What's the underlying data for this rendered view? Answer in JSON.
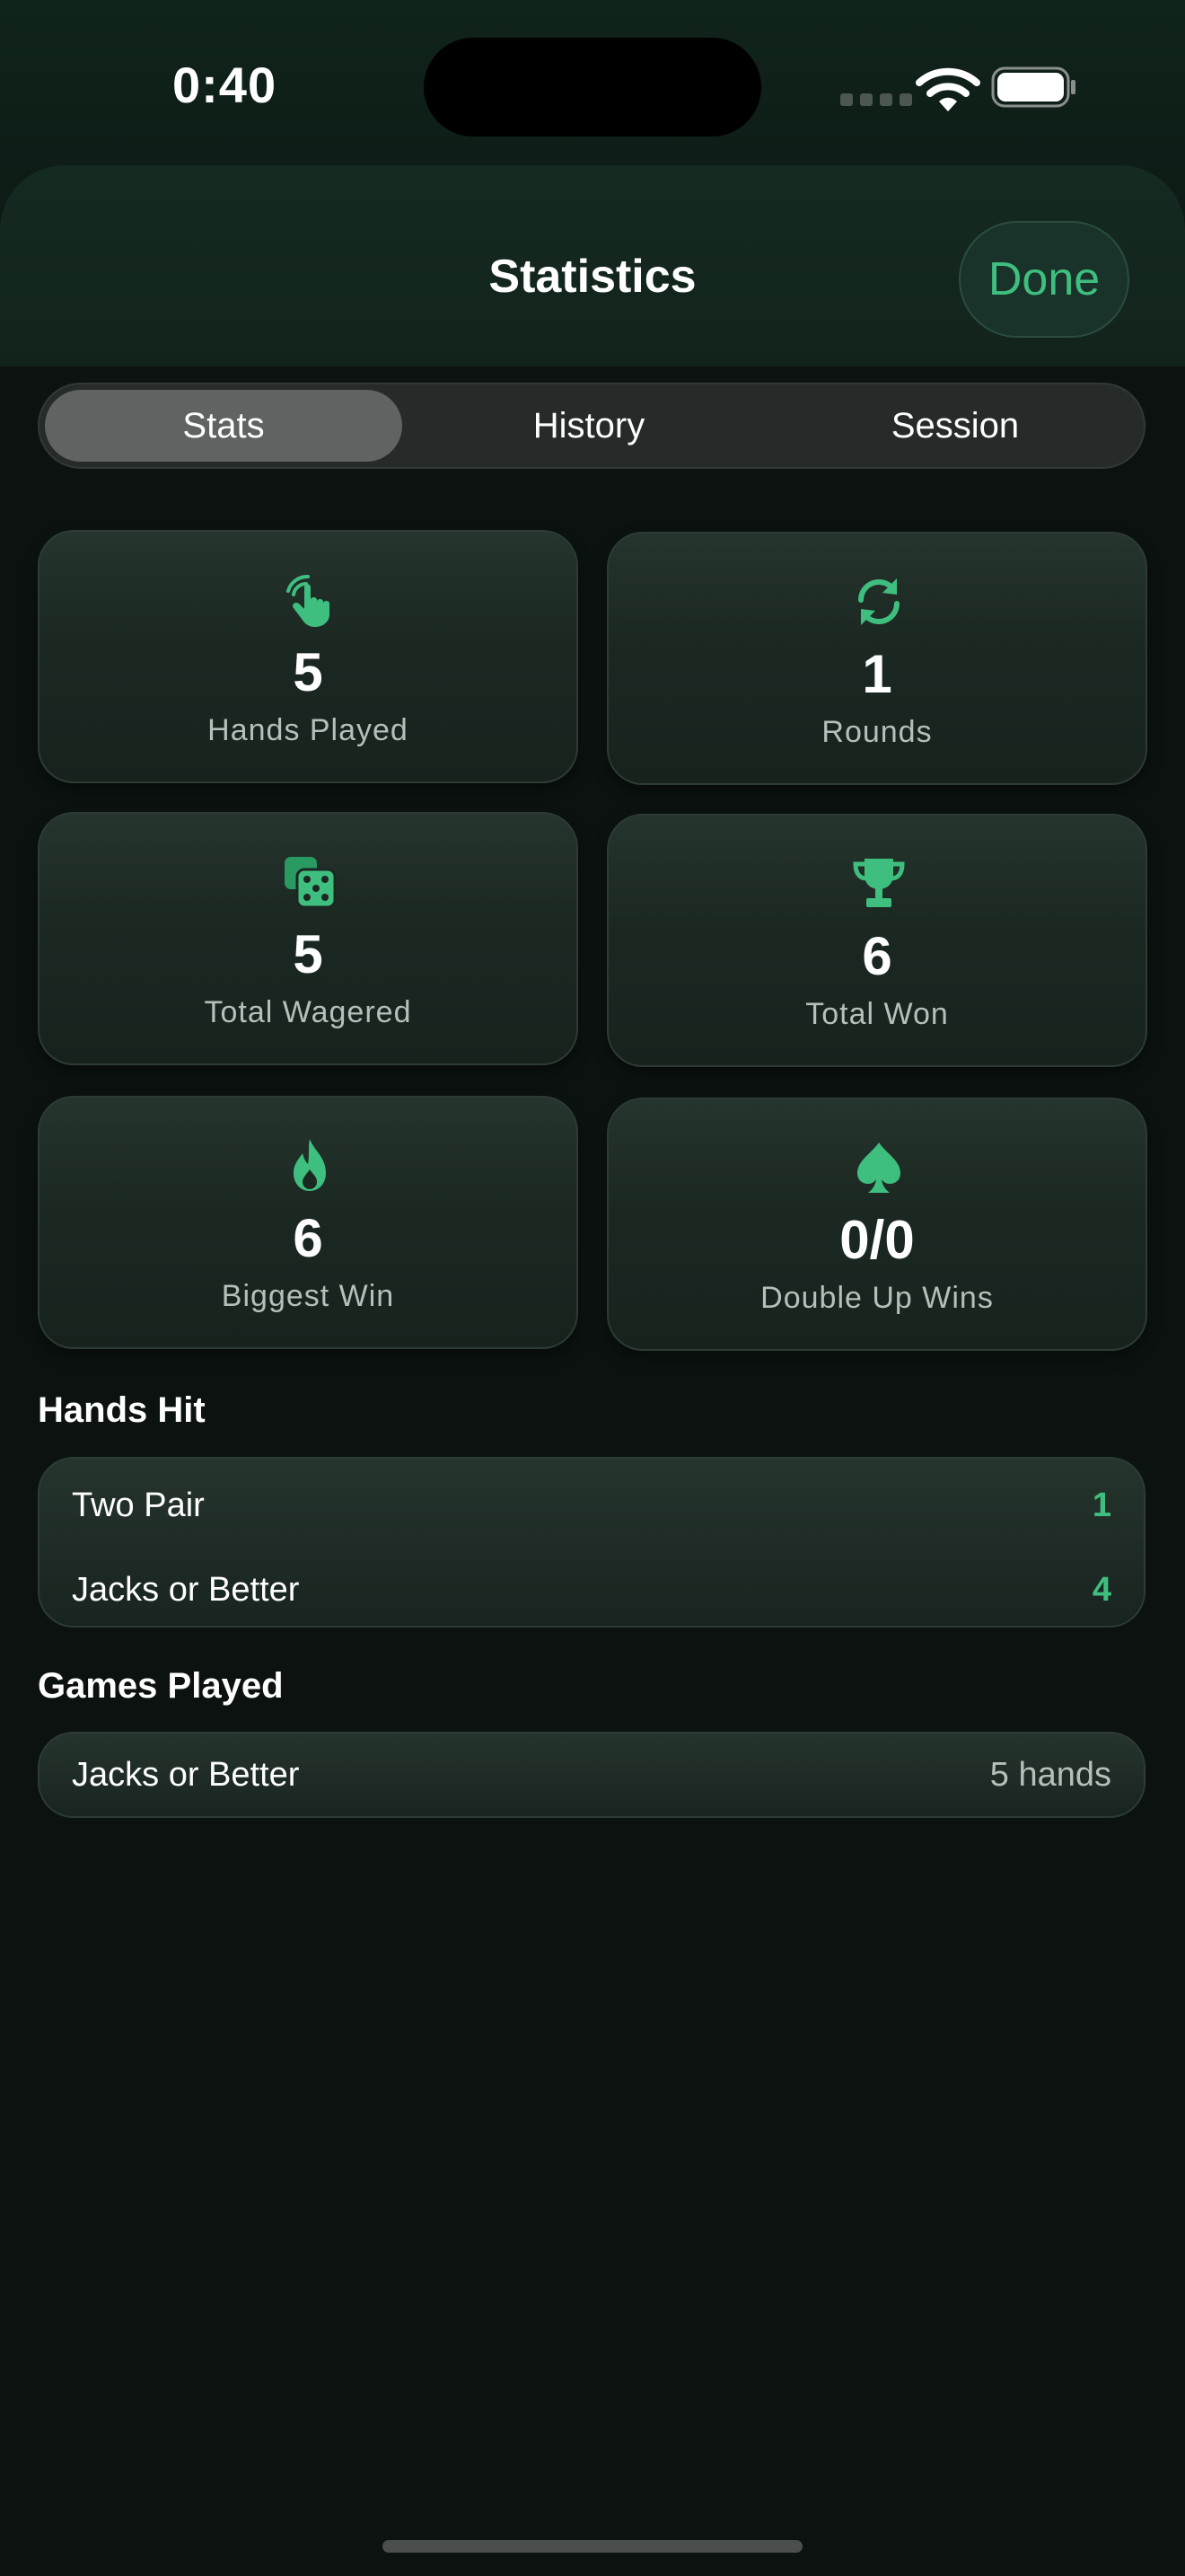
{
  "status_bar": {
    "time": "0:40"
  },
  "header": {
    "title": "Statistics",
    "done_label": "Done"
  },
  "tabs": [
    {
      "label": "Stats",
      "active": true
    },
    {
      "label": "History",
      "active": false
    },
    {
      "label": "Session",
      "active": false
    }
  ],
  "stats": [
    {
      "icon": "hand-tap-icon",
      "value": "5",
      "label": "Hands Played"
    },
    {
      "icon": "refresh-icon",
      "value": "1",
      "label": "Rounds"
    },
    {
      "icon": "dice-icon",
      "value": "5",
      "label": "Total Wagered"
    },
    {
      "icon": "trophy-icon",
      "value": "6",
      "label": "Total Won"
    },
    {
      "icon": "flame-icon",
      "value": "6",
      "label": "Biggest Win"
    },
    {
      "icon": "spade-icon",
      "value": "0/0",
      "label": "Double Up Wins"
    }
  ],
  "hands_hit": {
    "title": "Hands Hit",
    "rows": [
      {
        "label": "Two Pair",
        "value": "1"
      },
      {
        "label": "Jacks or Better",
        "value": "4"
      }
    ]
  },
  "games_played": {
    "title": "Games Played",
    "rows": [
      {
        "label": "Jacks or Better",
        "value": "5 hands"
      }
    ]
  },
  "colors": {
    "accent": "#3fbf7f",
    "background": "#0a110e",
    "card": "#1b2822"
  }
}
